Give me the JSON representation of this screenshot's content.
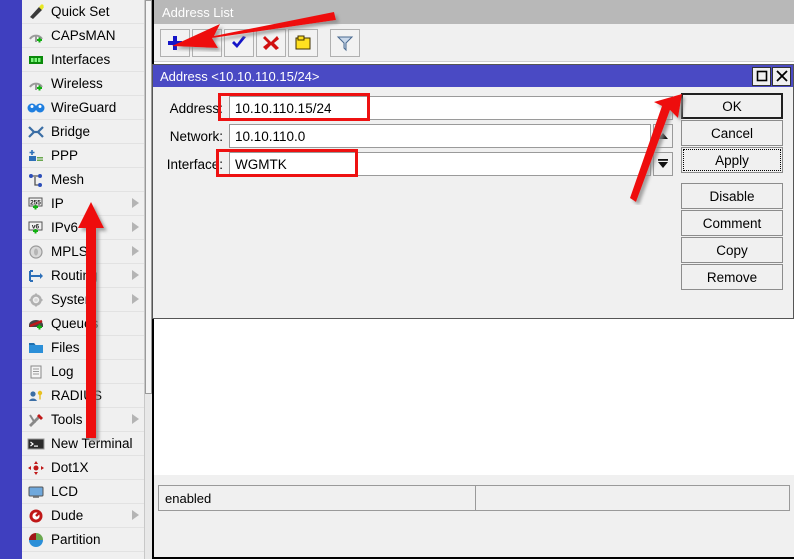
{
  "sidebar": {
    "items": [
      {
        "label": "Quick Set",
        "icon": "quickset-icon",
        "submenu": false
      },
      {
        "label": "CAPsMAN",
        "icon": "capsman-icon",
        "submenu": false
      },
      {
        "label": "Interfaces",
        "icon": "interfaces-icon",
        "submenu": false
      },
      {
        "label": "Wireless",
        "icon": "wireless-icon",
        "submenu": false
      },
      {
        "label": "WireGuard",
        "icon": "wireguard-icon",
        "submenu": false
      },
      {
        "label": "Bridge",
        "icon": "bridge-icon",
        "submenu": false
      },
      {
        "label": "PPP",
        "icon": "ppp-icon",
        "submenu": false
      },
      {
        "label": "Mesh",
        "icon": "mesh-icon",
        "submenu": false
      },
      {
        "label": "IP",
        "icon": "ip-icon",
        "submenu": true
      },
      {
        "label": "IPv6",
        "icon": "ipv6-icon",
        "submenu": true
      },
      {
        "label": "MPLS",
        "icon": "mpls-icon",
        "submenu": true
      },
      {
        "label": "Routing",
        "icon": "routing-icon",
        "submenu": true
      },
      {
        "label": "System",
        "icon": "system-icon",
        "submenu": true
      },
      {
        "label": "Queues",
        "icon": "queues-icon",
        "submenu": false
      },
      {
        "label": "Files",
        "icon": "files-icon",
        "submenu": false
      },
      {
        "label": "Log",
        "icon": "log-icon",
        "submenu": false
      },
      {
        "label": "RADIUS",
        "icon": "radius-icon",
        "submenu": false
      },
      {
        "label": "Tools",
        "icon": "tools-icon",
        "submenu": true
      },
      {
        "label": "New Terminal",
        "icon": "terminal-icon",
        "submenu": false
      },
      {
        "label": "Dot1X",
        "icon": "dot1x-icon",
        "submenu": false
      },
      {
        "label": "LCD",
        "icon": "lcd-icon",
        "submenu": false
      },
      {
        "label": "Dude",
        "icon": "dude-icon",
        "submenu": true
      },
      {
        "label": "Partition",
        "icon": "partition-icon",
        "submenu": false
      }
    ]
  },
  "address_list_window": {
    "title": "Address List",
    "toolbar": [
      {
        "name": "add-button",
        "icon": "plus-icon",
        "label": "+"
      },
      {
        "name": "remove-button",
        "icon": "minus-icon",
        "label": "-"
      },
      {
        "name": "enable-button",
        "icon": "check-icon",
        "label": "check"
      },
      {
        "name": "disable-button",
        "icon": "cross-icon",
        "label": "x"
      },
      {
        "name": "comment-button",
        "icon": "note-icon",
        "label": "note"
      },
      {
        "name": "filter-button",
        "icon": "funnel-icon",
        "label": "filter"
      }
    ],
    "status_left": "enabled",
    "status_right": ""
  },
  "address_dialog": {
    "title": "Address <10.10.110.15/24>",
    "window_buttons": {
      "maximize": "maximize-icon",
      "close": "close-icon"
    },
    "fields": [
      {
        "label": "Address:",
        "value": "10.10.110.15/24",
        "placeholder": ""
      },
      {
        "label": "Network:",
        "value": "10.10.110.0",
        "placeholder": ""
      },
      {
        "label": "Interface:",
        "value": "WGMTK",
        "placeholder": ""
      }
    ],
    "buttons": [
      {
        "label": "OK",
        "state": "primary"
      },
      {
        "label": "Cancel",
        "state": "normal"
      },
      {
        "label": "Apply",
        "state": "focused"
      },
      {
        "label": "Disable",
        "state": "normal"
      },
      {
        "label": "Comment",
        "state": "normal"
      },
      {
        "label": "Copy",
        "state": "normal"
      },
      {
        "label": "Remove",
        "state": "normal"
      }
    ]
  },
  "annotations": {
    "arrow_color": "#ee1111",
    "arrows": [
      {
        "name": "arrow-to-add-button",
        "target": "add-button"
      },
      {
        "name": "arrow-to-ip-menu",
        "target": "sidebar-item-ip"
      },
      {
        "name": "arrow-to-ok-button",
        "target": "ok-button"
      }
    ],
    "highlights": [
      {
        "name": "highlight-address-field",
        "target": "address-field"
      },
      {
        "name": "highlight-interface-field",
        "target": "interface-field"
      }
    ]
  },
  "colors": {
    "sidebar_strip": "#3f3fbf",
    "dialog_titlebar": "#4a4ac4",
    "window_titlebar": "#b8b8b8",
    "annotation_red": "#ee1111",
    "panel_bg": "#f0f0f0"
  }
}
